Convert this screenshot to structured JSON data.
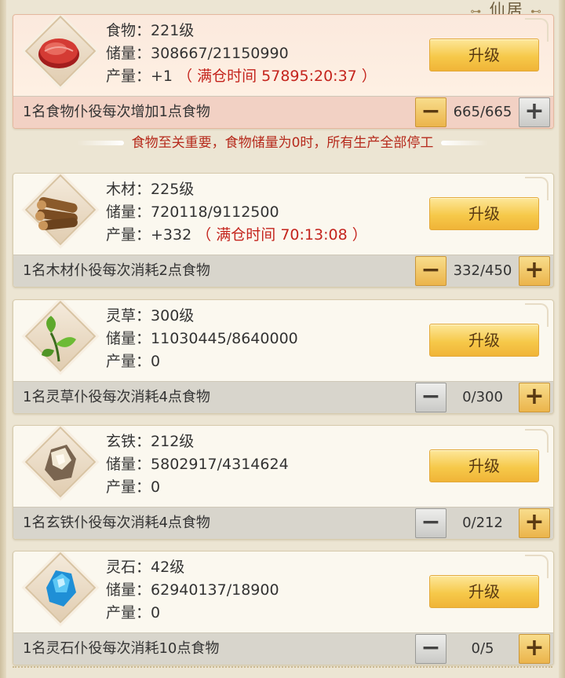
{
  "header": {
    "title": "仙居"
  },
  "notice": "食物至关重要，食物储量为0时，所有生产全部停工",
  "labels": {
    "storage": "储量：",
    "output": "产量：",
    "upgrade": "升级"
  },
  "resources": [
    {
      "name": "食物",
      "level": "221级",
      "storage": "308667/21150990",
      "output": "+1",
      "full_time": "（ 满仓时间 57895:20:37 ）",
      "bar_text": "1名食物仆役每次增加1点食物",
      "count": "665/665",
      "icon": "meat-icon",
      "minus_style": "gold",
      "plus_style": "gray"
    },
    {
      "name": "木材",
      "level": "225级",
      "storage": "720118/9112500",
      "output": "+332",
      "full_time": "（ 满仓时间 70:13:08 ）",
      "bar_text": "1名木材仆役每次消耗2点食物",
      "count": "332/450",
      "icon": "wood-logs-icon",
      "minus_style": "gold",
      "plus_style": "gold"
    },
    {
      "name": "灵草",
      "level": "300级",
      "storage": "11030445/8640000",
      "output": "0",
      "full_time": "",
      "bar_text": "1名灵草仆役每次消耗4点食物",
      "count": "0/300",
      "icon": "herb-leaf-icon",
      "minus_style": "gray",
      "plus_style": "gold"
    },
    {
      "name": "玄铁",
      "level": "212级",
      "storage": "5802917/4314624",
      "output": "0",
      "full_time": "",
      "bar_text": "1名玄铁仆役每次消耗4点食物",
      "count": "0/212",
      "icon": "iron-ore-icon",
      "minus_style": "gray",
      "plus_style": "gold"
    },
    {
      "name": "灵石",
      "level": "42级",
      "storage": "62940137/18900",
      "output": "0",
      "full_time": "",
      "bar_text": "1名灵石仆役每次消耗10点食物",
      "count": "0/5",
      "icon": "spirit-crystal-icon",
      "minus_style": "gray",
      "plus_style": "gold"
    }
  ],
  "colors": {
    "accent_red": "#c4241d",
    "button_gold": "#f6c94a",
    "card_bg": "#fbf8ef"
  }
}
